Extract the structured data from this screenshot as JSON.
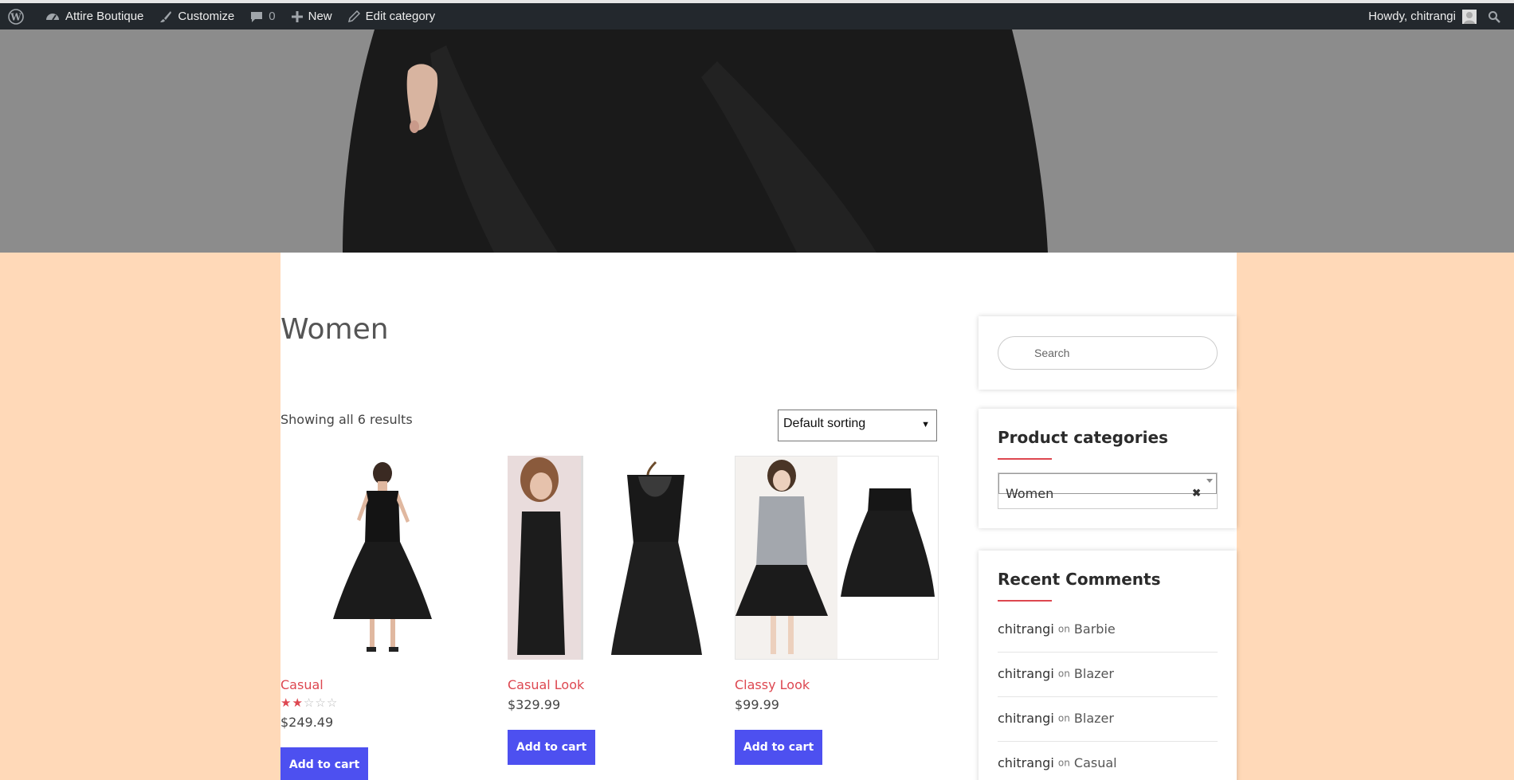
{
  "adminbar": {
    "site_name": "Attire Boutique",
    "customize": "Customize",
    "comments_count": "0",
    "new_label": "New",
    "edit_label": "Edit category",
    "howdy": "Howdy, chitrangi"
  },
  "page": {
    "title": "Women",
    "result_count": "Showing all 6 results",
    "sorting": "Default sorting"
  },
  "products": [
    {
      "title": "Casual",
      "price": "$249.49",
      "rating": 2,
      "rating_max": 5,
      "button": "Add to cart"
    },
    {
      "title": "Casual Look",
      "price": "$329.99",
      "button": "Add to cart"
    },
    {
      "title": "Classy Look",
      "price": "$99.99",
      "button": "Add to cart"
    }
  ],
  "sidebar": {
    "search_placeholder": "Search",
    "categories_title": "Product categories",
    "selected_category": "Women",
    "recent_comments_title": "Recent Comments",
    "comments": [
      {
        "author": "chitrangi",
        "on": "on",
        "post": "Barbie"
      },
      {
        "author": "chitrangi",
        "on": "on",
        "post": "Blazer"
      },
      {
        "author": "chitrangi",
        "on": "on",
        "post": "Blazer"
      },
      {
        "author": "chitrangi",
        "on": "on",
        "post": "Casual"
      }
    ]
  },
  "colors": {
    "accent": "#dd4750",
    "button": "#4d50f0",
    "background": "#ffd9b8",
    "adminbar": "#23282d"
  }
}
